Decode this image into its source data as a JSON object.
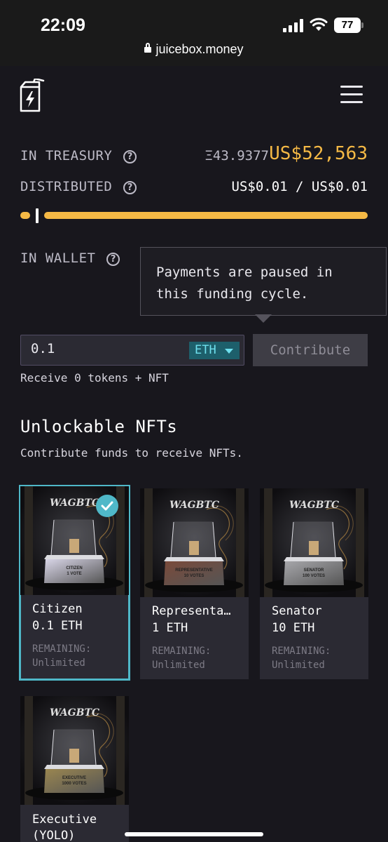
{
  "status": {
    "time": "22:09",
    "battery": "77",
    "url": "juicebox.money"
  },
  "treasury": {
    "label": "IN TREASURY",
    "eth": "Ξ43.9377",
    "usd": "US$52,563"
  },
  "distributed": {
    "label": "DISTRIBUTED",
    "value": "US$0.01 / US$0.01",
    "progress_fraction": 1.0
  },
  "wallet": {
    "label": "IN WALLET"
  },
  "tooltip": {
    "text": "Payments are paused in this funding cycle."
  },
  "pay": {
    "amount": "0.1",
    "currency": "ETH",
    "button": "Contribute",
    "receive": "Receive 0 tokens + NFT"
  },
  "nfts": {
    "title": "Unlockable NFTs",
    "subtitle": "Contribute funds to receive NFTs.",
    "remaining_label": "REMAINING:",
    "items": [
      {
        "name": "Citizen",
        "price": "0.1 ETH",
        "remaining": "Unlimited",
        "selected": true,
        "brand": "WAGBTC",
        "plaque_line1": "CITIZEN",
        "plaque_line2": "1 VOTE",
        "plaque_color": "#d9d6e8"
      },
      {
        "name": "Representative",
        "name_display": "Representa…",
        "price": "1 ETH",
        "remaining": "Unlimited",
        "selected": false,
        "brand": "WAGBTC",
        "plaque_line1": "REPRESENTATIVE",
        "plaque_line2": "10 VOTES",
        "plaque_color": "#7a4a3a"
      },
      {
        "name": "Senator",
        "price": "10 ETH",
        "remaining": "Unlimited",
        "selected": false,
        "brand": "WAGBTC",
        "plaque_line1": "SENATOR",
        "plaque_line2": "100 VOTES",
        "plaque_color": "#a7a7ab"
      },
      {
        "name": "Executive (YOLO)",
        "name_line1": "Executive",
        "name_line2": "(YOLO)",
        "selected": false,
        "brand": "WAGBTC",
        "plaque_line1": "EXECUTIVE",
        "plaque_line2": "1000 VOTES",
        "plaque_color": "#9a8650"
      }
    ]
  },
  "colors": {
    "accent": "#f5b945",
    "teal": "#4fb8c8",
    "background": "#18171d"
  }
}
